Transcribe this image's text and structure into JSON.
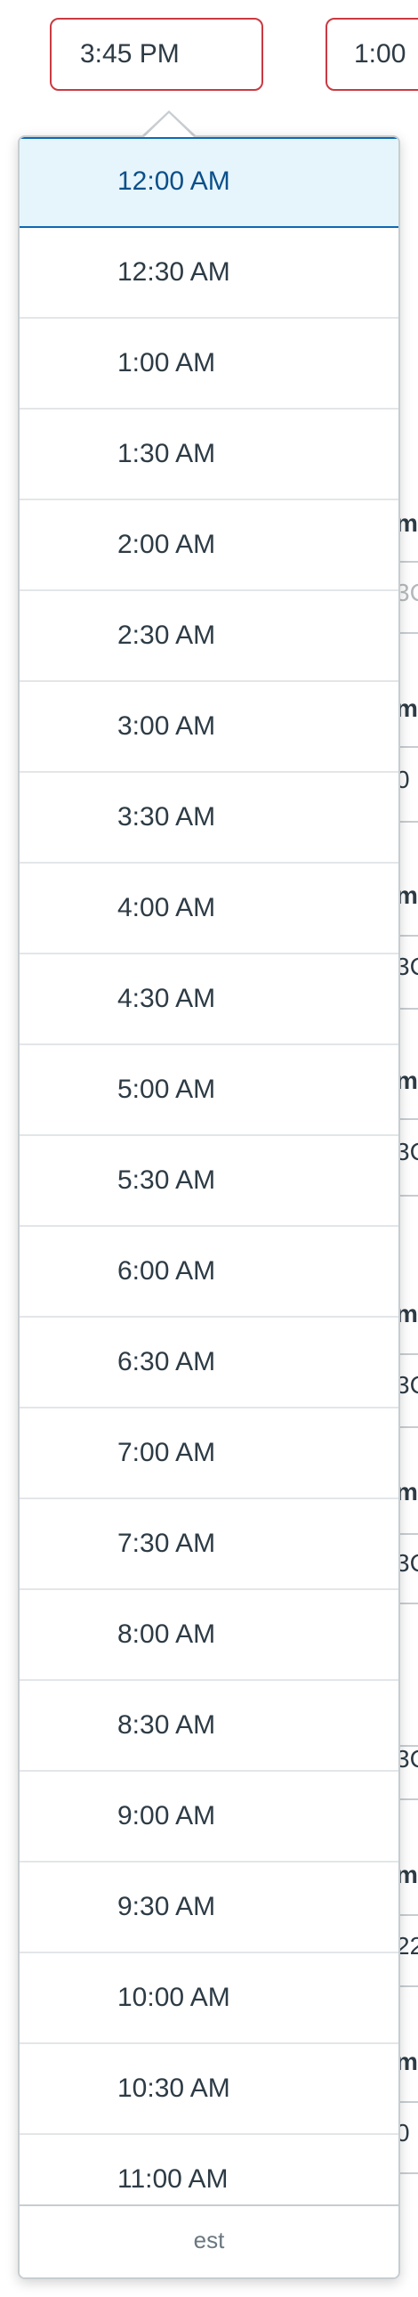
{
  "time_inputs": {
    "start_value": "3:45 PM",
    "end_value": "1:00"
  },
  "background_fragments": [
    {
      "text": "m",
      "style": "bold"
    },
    {
      "text": "3C",
      "style": "gray"
    },
    {
      "text": "m",
      "style": "bold"
    },
    {
      "text": "0",
      "style": "normal"
    },
    {
      "text": "m",
      "style": "bold"
    },
    {
      "text": "3C",
      "style": "normal"
    },
    {
      "text": "m",
      "style": "bold"
    },
    {
      "text": "3C",
      "style": "normal"
    },
    {
      "text": "m",
      "style": "bold"
    },
    {
      "text": "3C",
      "style": "normal"
    },
    {
      "text": "m",
      "style": "bold"
    },
    {
      "text": "3C",
      "style": "normal"
    },
    {
      "text": "3C",
      "style": "normal"
    },
    {
      "text": "m",
      "style": "bold"
    },
    {
      "text": "22",
      "style": "normal"
    },
    {
      "text": "m",
      "style": "bold"
    },
    {
      "text": "0",
      "style": "normal"
    }
  ],
  "time_dropdown": {
    "selected_index": 0,
    "options": [
      "12:00 AM",
      "12:30 AM",
      "1:00 AM",
      "1:30 AM",
      "2:00 AM",
      "2:30 AM",
      "3:00 AM",
      "3:30 AM",
      "4:00 AM",
      "4:30 AM",
      "5:00 AM",
      "5:30 AM",
      "6:00 AM",
      "6:30 AM",
      "7:00 AM",
      "7:30 AM",
      "8:00 AM",
      "8:30 AM",
      "9:00 AM",
      "9:30 AM",
      "10:00 AM",
      "10:30 AM",
      "11:00 AM"
    ],
    "footer_label": "est"
  }
}
